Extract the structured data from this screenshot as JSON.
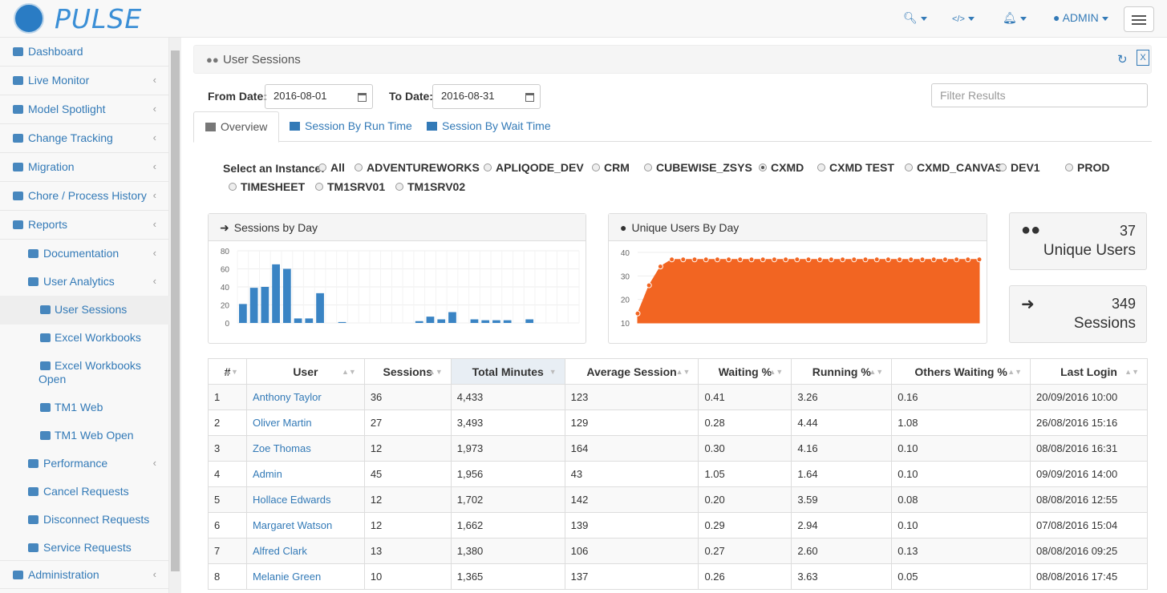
{
  "app": {
    "logo_text": "PULSE",
    "user_label": "ADMIN"
  },
  "sidebar": {
    "items": [
      {
        "label": "Dashboard",
        "icon": "monitor-icon",
        "chevron": false
      },
      {
        "label": "Live Monitor",
        "icon": "dashboard-gauge-icon",
        "chevron": true
      },
      {
        "label": "Model Spotlight",
        "icon": "spotlight-icon",
        "chevron": true
      },
      {
        "label": "Change Tracking",
        "icon": "eye-icon",
        "chevron": true
      },
      {
        "label": "Migration",
        "icon": "migration-icon",
        "chevron": true
      },
      {
        "label": "Chore / Process History",
        "icon": "history-icon",
        "chevron": true
      },
      {
        "label": "Reports",
        "icon": "reports-icon",
        "chevron": true
      }
    ],
    "sub_items": [
      {
        "label": "Documentation",
        "level": 1,
        "chevron": true
      },
      {
        "label": "User Analytics",
        "level": 1,
        "chevron": true
      },
      {
        "label": "User Sessions",
        "level": 2,
        "active": true
      },
      {
        "label": "Excel Workbooks",
        "level": 2
      },
      {
        "label": "Excel Workbooks Open",
        "level": 2
      },
      {
        "label": "TM1 Web",
        "level": 2
      },
      {
        "label": "TM1 Web Open",
        "level": 2
      },
      {
        "label": "Performance",
        "level": 1,
        "chevron": true
      },
      {
        "label": "Cancel Requests",
        "level": 1
      },
      {
        "label": "Disconnect Requests",
        "level": 1
      },
      {
        "label": "Service Requests",
        "level": 1
      }
    ],
    "admin": {
      "label": "Administration"
    }
  },
  "page": {
    "title": "User Sessions"
  },
  "filters": {
    "from_label": "From Date:",
    "from_value": "2016-08-01",
    "to_label": "To Date:",
    "to_value": "2016-08-31",
    "filter_placeholder": "Filter Results"
  },
  "tabs": [
    "Overview",
    "Session By Run Time",
    "Session By Wait Time"
  ],
  "instances": {
    "label": "Select an Instance:",
    "options": [
      "All",
      "ADVENTUREWORKS",
      "APLIQODE_DEV",
      "CRM",
      "CUBEWISE_ZSYS",
      "CXMD",
      "CXMD TEST",
      "CXMD_CANVAS",
      "DEV1",
      "PROD",
      "TIMESHEET",
      "TM1SRV01",
      "TM1SRV02"
    ],
    "selected": "CXMD"
  },
  "panels": {
    "sessions_title": "Sessions by Day",
    "users_title": "Unique Users By Day"
  },
  "stats": [
    {
      "value": "37",
      "caption": "Unique Users"
    },
    {
      "value": "349",
      "caption": "Sessions"
    }
  ],
  "chart_data": [
    {
      "type": "bar",
      "ylim": [
        0,
        80
      ],
      "yticks": [
        "80",
        "60",
        "40",
        "20",
        "0"
      ],
      "color": "#3a84c4",
      "values": [
        21,
        39,
        40,
        65,
        60,
        5,
        5,
        33,
        0,
        1,
        0,
        0,
        0,
        0,
        0,
        0,
        2,
        7,
        4,
        12,
        0,
        4,
        3,
        3,
        3,
        0,
        4,
        0,
        0,
        0,
        0
      ]
    },
    {
      "type": "area",
      "ylim": [
        10,
        40
      ],
      "yticks": [
        "40",
        "30",
        "20",
        "10"
      ],
      "color": "#f26522",
      "values": [
        14,
        26,
        34,
        37,
        37,
        37,
        37,
        37,
        37,
        37,
        37,
        37,
        37,
        37,
        37,
        37,
        37,
        37,
        37,
        37,
        37,
        37,
        37,
        37,
        37,
        37,
        37,
        37,
        37,
        37,
        37
      ]
    }
  ],
  "table": {
    "headers": [
      "#",
      "User",
      "Sessions",
      "Total Minutes",
      "Average Session",
      "Waiting %",
      "Running %",
      "Others Waiting %",
      "Last Login"
    ],
    "rows": [
      [
        "1",
        "Anthony Taylor",
        "36",
        "4,433",
        "123",
        "0.41",
        "3.26",
        "0.16",
        "20/09/2016 10:00"
      ],
      [
        "2",
        "Oliver Martin",
        "27",
        "3,493",
        "129",
        "0.28",
        "4.44",
        "1.08",
        "26/08/2016 15:16"
      ],
      [
        "3",
        "Zoe Thomas",
        "12",
        "1,973",
        "164",
        "0.30",
        "4.16",
        "0.10",
        "08/08/2016 16:31"
      ],
      [
        "4",
        "Admin",
        "45",
        "1,956",
        "43",
        "1.05",
        "1.64",
        "0.10",
        "09/09/2016 14:00"
      ],
      [
        "5",
        "Hollace Edwards",
        "12",
        "1,702",
        "142",
        "0.20",
        "3.59",
        "0.08",
        "08/08/2016 12:55"
      ],
      [
        "6",
        "Margaret Watson",
        "12",
        "1,662",
        "139",
        "0.29",
        "2.94",
        "0.10",
        "07/08/2016 15:04"
      ],
      [
        "7",
        "Alfred Clark",
        "13",
        "1,380",
        "106",
        "0.27",
        "2.60",
        "0.13",
        "08/08/2016 09:25"
      ],
      [
        "8",
        "Melanie Green",
        "10",
        "1,365",
        "137",
        "0.26",
        "3.63",
        "0.05",
        "08/08/2016 17:45"
      ]
    ]
  }
}
